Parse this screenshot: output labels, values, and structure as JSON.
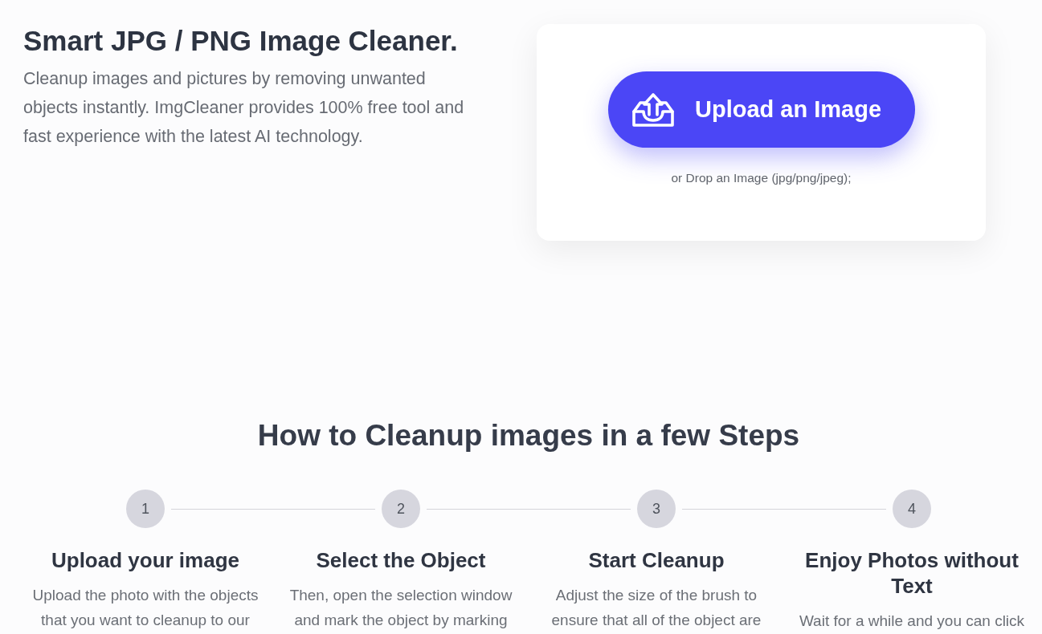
{
  "hero": {
    "title": "Smart JPG / PNG Image Cleaner.",
    "description_lines": [
      "Cleanup images and pictures by removing unwanted",
      "objects instantly. ImgCleaner provides 100% free tool and",
      "fast experience with the latest AI technology."
    ]
  },
  "upload_card": {
    "button": "Upload an Image",
    "hint": "or Drop an Image (jpg/png/jpeg);"
  },
  "steps_section": {
    "heading": "How to Cleanup images in a few Steps",
    "steps": [
      {
        "number": "1",
        "title_lines": [
          "Upload your image"
        ],
        "description_lines": [
          "Upload the photo with the objects",
          "that you want to cleanup to our"
        ]
      },
      {
        "number": "2",
        "title_lines": [
          "Select the Object"
        ],
        "description_lines": [
          "Then, open the selection window",
          "and mark the object by marking"
        ]
      },
      {
        "number": "3",
        "title_lines": [
          "Start Cleanup"
        ],
        "description_lines": [
          "Adjust the size of the brush to",
          "ensure that all of the object are"
        ]
      },
      {
        "number": "4",
        "title_lines": [
          "Enjoy Photos without",
          "Text"
        ],
        "description_lines": [
          "Wait for a while and you can click"
        ]
      }
    ]
  }
}
